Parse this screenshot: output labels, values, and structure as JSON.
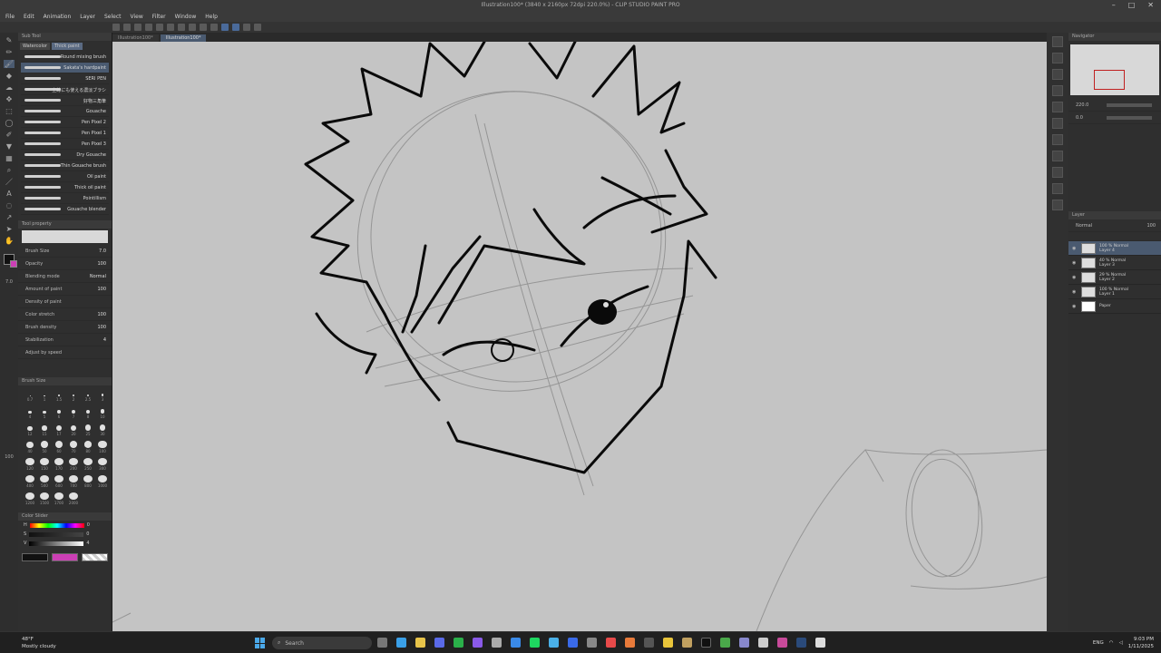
{
  "window": {
    "title": "Illustration100* (3840 x 2160px 72dpi 220.0%)  - CLIP STUDIO PAINT PRO"
  },
  "menu": [
    "File",
    "Edit",
    "Animation",
    "Layer",
    "Select",
    "View",
    "Filter",
    "Window",
    "Help"
  ],
  "document_tabs": [
    "Illustration100*",
    "Illustration100*"
  ],
  "sub_tool": {
    "header": "Sub Tool",
    "tabs": [
      "Watercolor",
      "Thick paint"
    ],
    "brushes": [
      {
        "name": "Round mixing brush",
        "selected": false
      },
      {
        "name": "Sakata's hardpaint",
        "selected": true
      },
      {
        "name": "SERI PEN",
        "selected": false
      },
      {
        "name": "主線にも使える濃淡ブラシ",
        "selected": false
      },
      {
        "name": "好物三角筆",
        "selected": false
      },
      {
        "name": "Gouache",
        "selected": false
      },
      {
        "name": "Pen Pixel 2",
        "selected": false
      },
      {
        "name": "Pen Pixel 1",
        "selected": false
      },
      {
        "name": "Pen Pixel 3",
        "selected": false
      },
      {
        "name": "Dry Gouache",
        "selected": false
      },
      {
        "name": "Thin Gouache brush",
        "selected": false
      },
      {
        "name": "Oil paint",
        "selected": false
      },
      {
        "name": "Thick oil paint",
        "selected": false
      },
      {
        "name": "Pointillism",
        "selected": false
      },
      {
        "name": "Gouache blender",
        "selected": false
      }
    ]
  },
  "tool_property": {
    "header": "Tool property",
    "rows": [
      {
        "label": "Brush Size",
        "value": "7.0"
      },
      {
        "label": "Opacity",
        "value": "100"
      },
      {
        "label": "Blending mode",
        "value": "Normal"
      },
      {
        "label": "Amount of paint",
        "value": "100"
      },
      {
        "label": "Density of paint",
        "value": ""
      },
      {
        "label": "Color stretch",
        "value": "100"
      },
      {
        "label": "Brush density",
        "value": "100"
      },
      {
        "label": "Stabilization",
        "value": "4"
      }
    ],
    "adjust_by_speed": "Adjust by speed"
  },
  "brush_size": {
    "header": "Brush Size",
    "sizes": [
      "0.7",
      "1",
      "1.5",
      "2",
      "2.5",
      "3",
      "4",
      "5",
      "6",
      "7",
      "8",
      "10",
      "12",
      "15",
      "17",
      "20",
      "25",
      "30",
      "40",
      "50",
      "60",
      "70",
      "80",
      "100",
      "120",
      "150",
      "170",
      "200",
      "250",
      "300",
      "400",
      "500",
      "600",
      "700",
      "800",
      "1000",
      "1200",
      "1500",
      "1700",
      "2000"
    ]
  },
  "color_slider": {
    "header": "Color Slider",
    "h": "0",
    "s": "0",
    "v": "4"
  },
  "left_values": {
    "brush_size": "7.0",
    "opacity": "100"
  },
  "navigator": {
    "header": "Navigator",
    "zoom": "220.0",
    "angle": "0.0"
  },
  "layers": {
    "header": "Layer",
    "blend": "Normal",
    "opacity": "100",
    "items": [
      {
        "name": "Layer 4",
        "info": "100 % Normal",
        "selected": true
      },
      {
        "name": "Layer 3",
        "info": "40 % Normal",
        "selected": false
      },
      {
        "name": "Layer 2",
        "info": "29 % Normal",
        "selected": false
      },
      {
        "name": "Layer 1",
        "info": "100 % Normal",
        "selected": false
      },
      {
        "name": "Paper",
        "info": "",
        "selected": false
      }
    ]
  },
  "colors": {
    "main": "#111111",
    "sub": "#cc3fb5",
    "accent": "#4a5a70"
  },
  "taskbar": {
    "weather_temp": "48°F",
    "weather_desc": "Mostly cloudy",
    "search_placeholder": "Search",
    "lang": "ENG",
    "time": "9:03 PM",
    "date": "1/11/2025"
  }
}
